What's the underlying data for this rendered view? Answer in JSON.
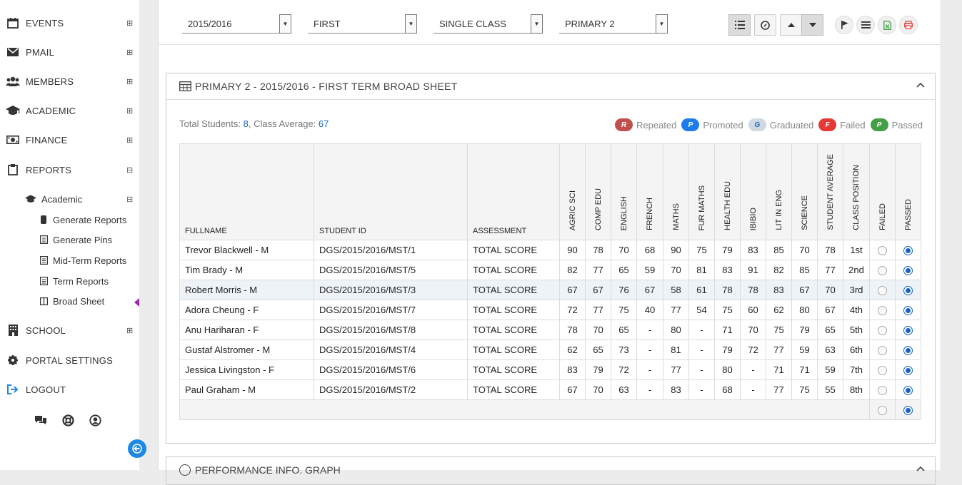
{
  "sidebar": {
    "items": [
      {
        "label": "EVENTS",
        "icon": "calendar-icon",
        "expander": "⊞"
      },
      {
        "label": "PMAIL",
        "icon": "mail-icon",
        "expander": "⊞"
      },
      {
        "label": "MEMBERS",
        "icon": "users-icon",
        "expander": "⊞"
      },
      {
        "label": "ACADEMIC",
        "icon": "graduation-cap-icon",
        "expander": "⊞"
      },
      {
        "label": "FINANCE",
        "icon": "money-icon",
        "expander": "⊞"
      },
      {
        "label": "REPORTS",
        "icon": "clipboard-icon",
        "expander": "⊟"
      },
      {
        "label": "SCHOOL",
        "icon": "building-icon",
        "expander": "⊞"
      },
      {
        "label": "PORTAL SETTINGS",
        "icon": "gear-icon",
        "expander": ""
      },
      {
        "label": "LOGOUT",
        "icon": "logout-icon",
        "expander": ""
      }
    ],
    "reports_sub": {
      "label": "Academic",
      "icon": "graduation-cap-icon",
      "expander": "⊟"
    },
    "academic_sub": [
      {
        "label": "Generate Reports",
        "icon": "file-icon"
      },
      {
        "label": "Generate Pins",
        "icon": "list-icon"
      },
      {
        "label": "Mid-Term Reports",
        "icon": "list-icon"
      },
      {
        "label": "Term Reports",
        "icon": "list-icon"
      },
      {
        "label": "Broad Sheet",
        "icon": "columns-icon"
      }
    ],
    "footer_icons": [
      "chat-icon",
      "support-icon",
      "user-circle-icon"
    ],
    "collapse_icon": "arrow-left-icon",
    "accent": "#1e88e5"
  },
  "filters": {
    "session": "2015/2016",
    "term": "FIRST",
    "mode": "SINGLE CLASS",
    "class": "PRIMARY 2"
  },
  "toolbar": {
    "icons": [
      "list-view-icon",
      "compass-icon",
      "sort-up-icon",
      "sort-down-icon",
      "flag-icon",
      "menu-icon",
      "excel-icon",
      "pdf-icon"
    ]
  },
  "panel": {
    "title": "PRIMARY 2 - 2015/2016 - FIRST TERM BROAD SHEET",
    "stats_prefix": "Total Students: ",
    "total_students": "8",
    "stats_mid": ", Class Average: ",
    "class_average": "67",
    "legend": [
      {
        "badge": "R",
        "label": "Repeated",
        "color": "#c0504d"
      },
      {
        "badge": "P",
        "label": "Promoted",
        "color": "#1e7bea"
      },
      {
        "badge": "G",
        "label": "Graduated",
        "color": "#cfd8e3"
      },
      {
        "badge": "F",
        "label": "Failed",
        "color": "#e53935"
      },
      {
        "badge": "P",
        "label": "Passed",
        "color": "#43a047"
      }
    ]
  },
  "table": {
    "headers": [
      "FULLNAME",
      "STUDENT ID",
      "ASSESSMENT",
      "AGRIC SCI",
      "COMP EDU",
      "ENGLISH",
      "FRENCH",
      "MATHS",
      "FUR MATHS",
      "HEALTH EDU",
      "IBIBIO",
      "LIT IN ENG",
      "SCIENCE",
      "STUDENT AVERAGE",
      "CLASS POSITION",
      "FAILED",
      "PASSED"
    ],
    "rows": [
      {
        "name": "Trevor  Blackwell - M",
        "id": "DGS/2015/2016/MST/1",
        "assessment": "TOTAL SCORE",
        "scores": [
          "90",
          "78",
          "70",
          "68",
          "90",
          "75",
          "79",
          "83",
          "85",
          "70"
        ],
        "average": "78",
        "position": "1st",
        "passed": true
      },
      {
        "name": "Tim  Brady - M",
        "id": "DGS/2015/2016/MST/5",
        "assessment": "TOTAL SCORE",
        "scores": [
          "82",
          "77",
          "65",
          "59",
          "70",
          "81",
          "83",
          "91",
          "82",
          "85"
        ],
        "average": "77",
        "position": "2nd",
        "passed": true
      },
      {
        "name": "Robert  Morris - M",
        "id": "DGS/2015/2016/MST/3",
        "assessment": "TOTAL SCORE",
        "scores": [
          "67",
          "67",
          "76",
          "67",
          "58",
          "61",
          "78",
          "78",
          "83",
          "67"
        ],
        "average": "70",
        "position": "3rd",
        "passed": true
      },
      {
        "name": "Adora  Cheung - F",
        "id": "DGS/2015/2016/MST/7",
        "assessment": "TOTAL SCORE",
        "scores": [
          "72",
          "77",
          "75",
          "40",
          "77",
          "54",
          "75",
          "60",
          "62",
          "80"
        ],
        "average": "67",
        "position": "4th",
        "passed": true
      },
      {
        "name": "Anu  Hariharan - F",
        "id": "DGS/2015/2016/MST/8",
        "assessment": "TOTAL SCORE",
        "scores": [
          "78",
          "70",
          "65",
          "-",
          "80",
          "-",
          "71",
          "70",
          "75",
          "79"
        ],
        "average": "65",
        "position": "5th",
        "passed": true
      },
      {
        "name": "Gustaf  Alstromer - M",
        "id": "DGS/2015/2016/MST/4",
        "assessment": "TOTAL SCORE",
        "scores": [
          "62",
          "65",
          "73",
          "-",
          "81",
          "-",
          "79",
          "72",
          "77",
          "59"
        ],
        "average": "63",
        "position": "6th",
        "passed": true
      },
      {
        "name": "Jessica  Livingston - F",
        "id": "DGS/2015/2016/MST/6",
        "assessment": "TOTAL SCORE",
        "scores": [
          "83",
          "79",
          "72",
          "-",
          "77",
          "-",
          "80",
          "-",
          "71",
          "71"
        ],
        "average": "59",
        "position": "7th",
        "passed": true
      },
      {
        "name": "Paul  Graham - M",
        "id": "DGS/2015/2016/MST/2",
        "assessment": "TOTAL SCORE",
        "scores": [
          "67",
          "70",
          "63",
          "-",
          "83",
          "-",
          "68",
          "-",
          "77",
          "75"
        ],
        "average": "55",
        "position": "8th",
        "passed": true
      }
    ]
  },
  "panel2": {
    "title": "PERFORMANCE INFO. GRAPH"
  }
}
